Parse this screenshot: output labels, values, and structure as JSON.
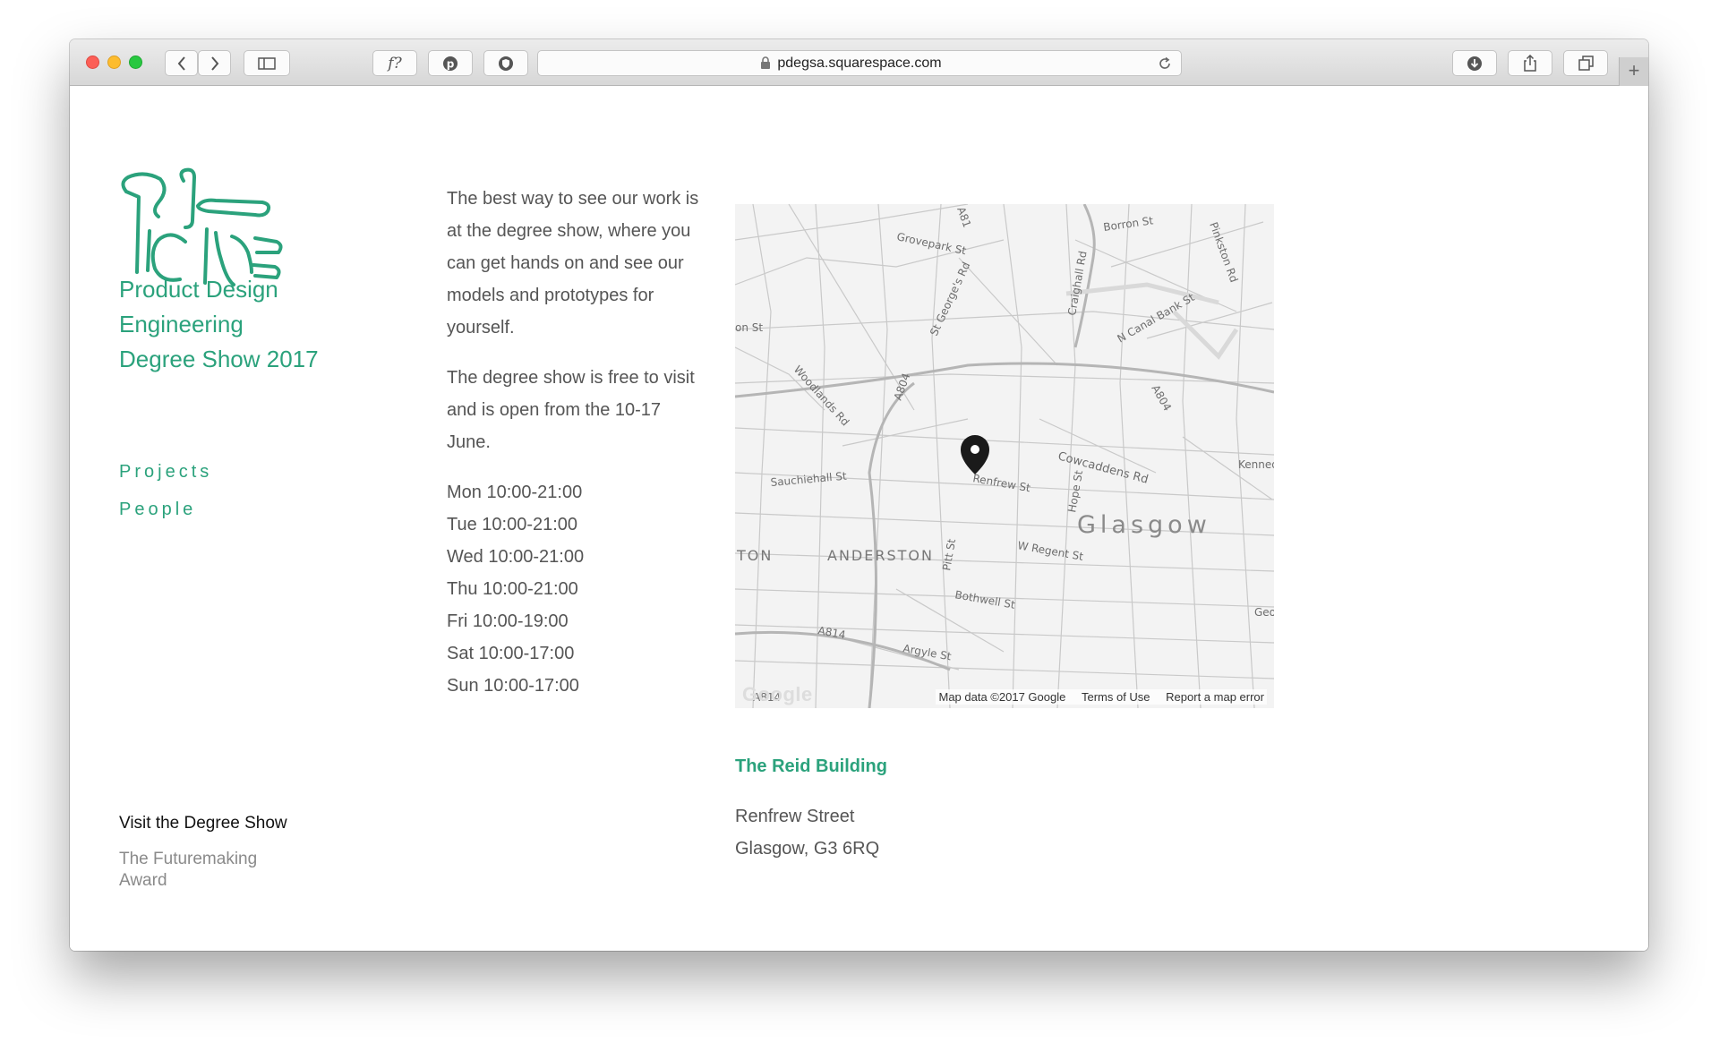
{
  "browser": {
    "url": "pdegsa.squarespace.com",
    "toolbar_buttons": [
      "back-icon",
      "forward-icon",
      "sidebar-icon",
      "font-icon",
      "pinterest-icon",
      "shield-icon",
      "reload-icon",
      "download-icon",
      "share-icon",
      "tabs-icon",
      "new-tab-icon"
    ],
    "font_button_label": "f?"
  },
  "site": {
    "title_line1": "Product Design",
    "title_line2": "Engineering",
    "title_line3": "Degree Show 2017",
    "accent_color": "#2ba27c"
  },
  "nav": {
    "projects": "Projects",
    "people": "People"
  },
  "footer_nav": {
    "visit": "Visit the Degree Show",
    "futuremaking": "The Futuremaking Award"
  },
  "intro": {
    "para1": "The best way to see our work is at the degree show, where you can get hands on and see our models and prototypes for yourself.",
    "para2": "The degree show is free to visit and is open from the 10-17 June."
  },
  "hours": [
    "Mon 10:00-21:00",
    "Tue 10:00-21:00",
    "Wed 10:00-21:00",
    "Thu 10:00-21:00",
    "Fri 10:00-19:00",
    "Sat 10:00-17:00",
    "Sun 10:00-17:00"
  ],
  "map": {
    "city_label": "Glasgow",
    "district_label": "ANDERSTON",
    "district_label2": "TON",
    "streets": [
      "Grovepark St",
      "Borron St",
      "Craighall Rd",
      "Pinkston Rd",
      "N Canal Bank St",
      "St George's Rd",
      "Woodlands Rd",
      "A804",
      "A804",
      "Cowcaddens Rd",
      "Sauchiehall St",
      "Renfrew St",
      "Hope St",
      "W Regent St",
      "Pitt St",
      "Bothwell St",
      "A814",
      "Argyle St",
      "Kenned",
      "Geo",
      "A81",
      "A814",
      "on St"
    ],
    "attribution_data": "Map data ©2017 Google",
    "attribution_terms": "Terms of Use",
    "attribution_report": "Report a map error",
    "google_logo": "Google"
  },
  "venue": {
    "name": "The Reid Building",
    "street": "Renfrew Street",
    "city": "Glasgow, G3 6RQ"
  }
}
